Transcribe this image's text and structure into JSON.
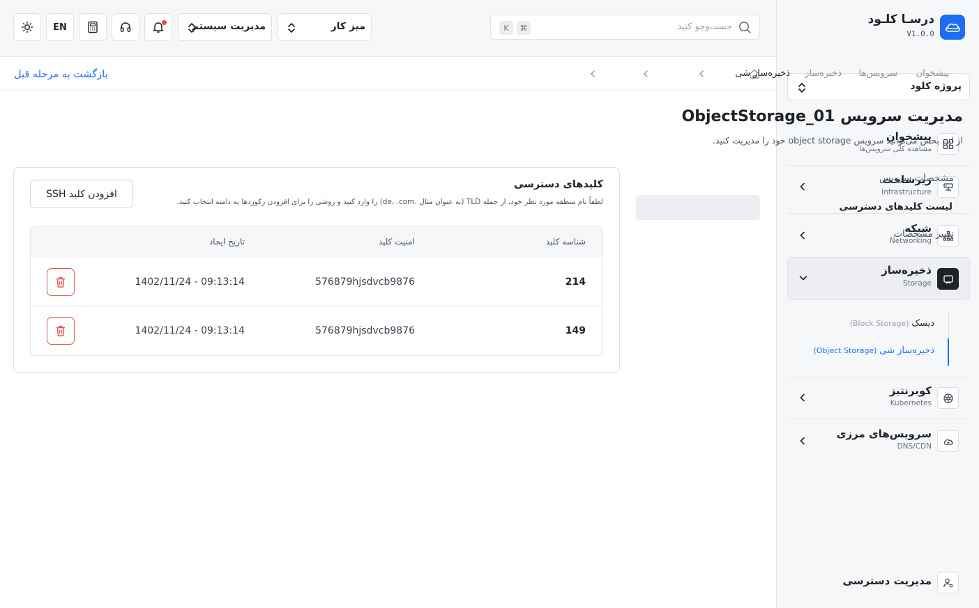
{
  "brand": {
    "name": "درسـا کلـود",
    "version": "V1.0.0"
  },
  "project": {
    "selected": "پروژه کلود"
  },
  "nav": {
    "dashboard": {
      "title": "پیشخوان",
      "sub": "مشاهده کلی سرویس‌ها"
    },
    "infrastructure": {
      "title": "زیرساخت",
      "sub": "Infrastructure"
    },
    "networking": {
      "title": "شبکه",
      "sub": "Networking"
    },
    "storage": {
      "title": "ذخیره‌ساز",
      "sub": "Storage",
      "items": [
        {
          "fa": "دیسک",
          "en": "(Block Storage)"
        },
        {
          "fa": "ذخیره‌ساز شی",
          "en": "(Object Storage)"
        }
      ]
    },
    "kubernetes": {
      "title": "کوبرنتیز",
      "sub": "Kubernetes"
    },
    "edge": {
      "title": "سرویس‌های مرزی",
      "sub": "DNS/CDN"
    },
    "access": {
      "title": "مدیریت دسترسی"
    }
  },
  "header": {
    "search_placeholder": "جست‌وجو کنید",
    "kbd_cmd": "⌘",
    "kbd_k": "K",
    "workspace": "میز کار",
    "system": "مدیریت سیستم",
    "lang": "EN"
  },
  "breadcrumb": {
    "items": [
      "پیشخوان",
      "سرویس‌ها",
      "ذخیره‌ساز",
      "ذخیره‌ساز شی"
    ],
    "back": "بازگشت به مرحله قبل"
  },
  "page": {
    "title": "مدیریت سرویس ObjectStorage_01",
    "desc": "از این بخش می‌توانید سرویس object storage خود را مدیریت کنید."
  },
  "tabs": [
    "مشخصات سرویس",
    "لیست کلیدهای دسترسی",
    "تغییر مشخصات"
  ],
  "card": {
    "title": "کلیدهای دسترسی",
    "desc": "لطفاً نام منطقه مورد نظر خود، از جمله TLD (به عنوان مثال .de، .com) را وارد کنید و روشی را برای افزودن رکوردها به دامنه انتخاب کنید.",
    "add_button": "افزودن کلید SSH"
  },
  "table": {
    "headers": {
      "id": "شناسه کلید",
      "secret": "امنیت کلید",
      "created": "تاریخ ایجاد"
    },
    "rows": [
      {
        "id": "214",
        "secret": "576879hjsdvcb9876",
        "created": "1402/11/24 - 09:13:14"
      },
      {
        "id": "149",
        "secret": "576879hjsdvcb9876",
        "created": "1402/11/24 - 09:13:14"
      }
    ]
  }
}
